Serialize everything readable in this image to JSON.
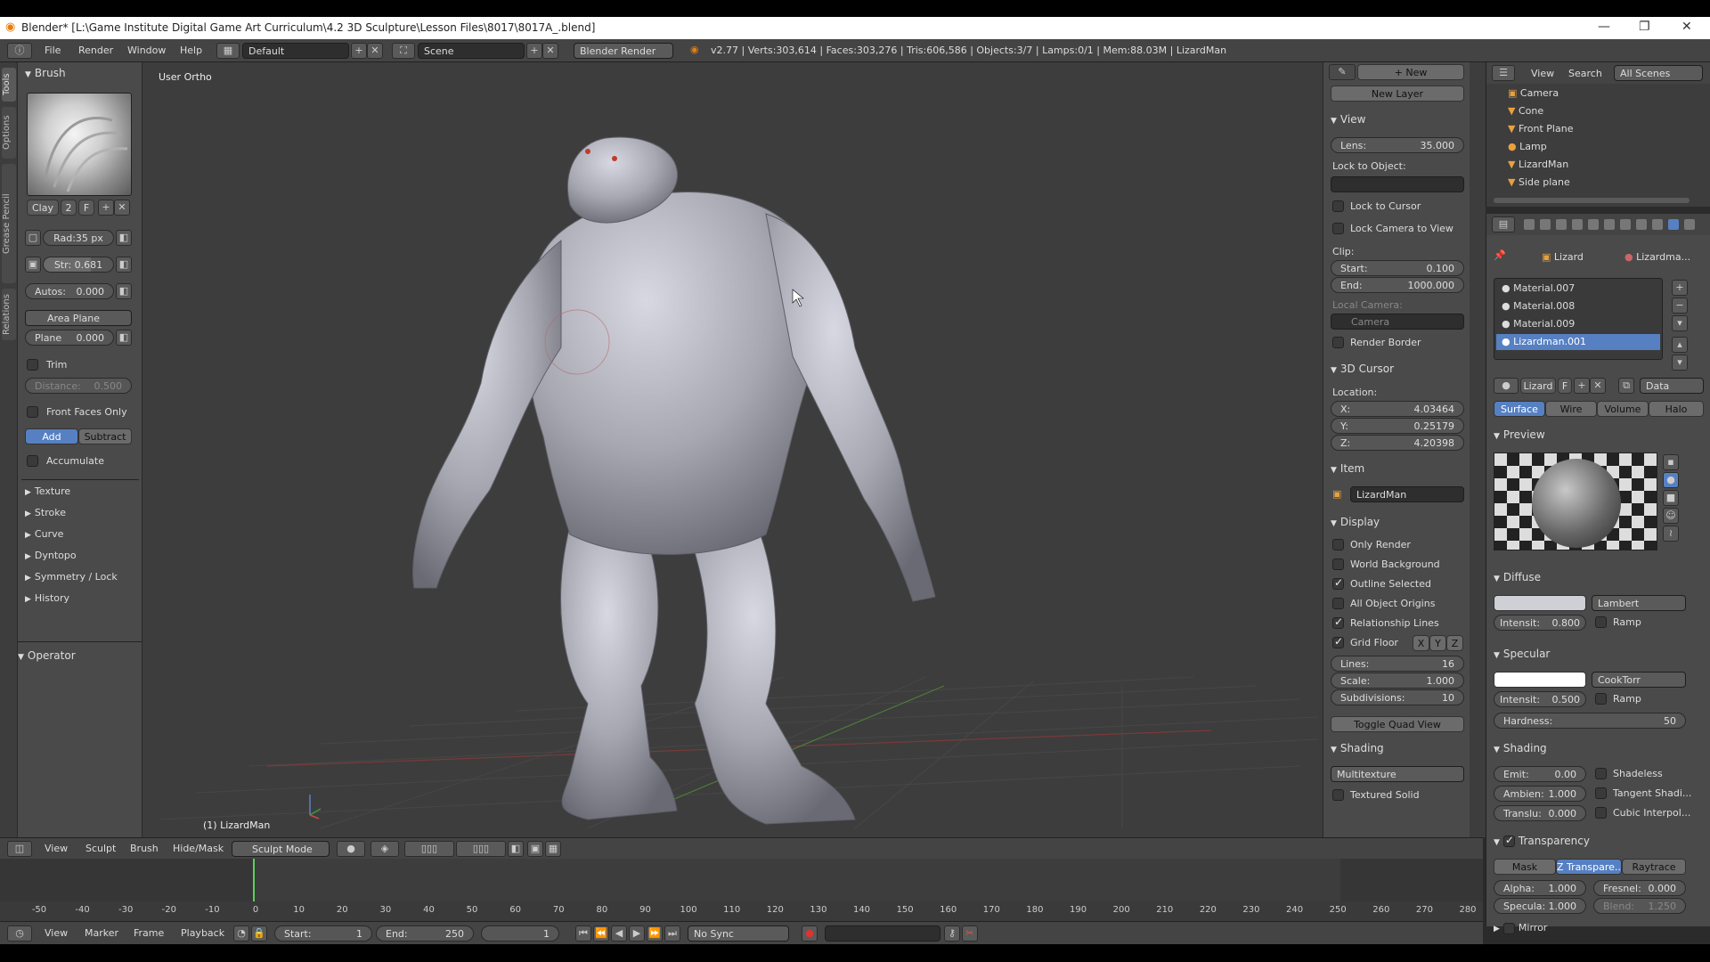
{
  "window": {
    "title": "Blender* [L:\\Game Institute Digital Game Art  Curriculum\\4.2 3D Sculpture\\Lesson Files\\8017\\8017A_.blend]",
    "minimize": "—",
    "maximize": "❐",
    "close": "✕"
  },
  "header": {
    "menu": [
      "File",
      "Render",
      "Window",
      "Help"
    ],
    "layout": "Default",
    "scene": "Scene",
    "engine": "Blender Render",
    "stats": "v2.77 | Verts:303,614 | Faces:303,276 | Tris:606,586 | Objects:3/7 | Lamps:0/1 | Mem:88.03M | LizardMan"
  },
  "left_tabs": [
    "Tools",
    "Options",
    "Grease Pencil",
    "Relations"
  ],
  "toolshelf": {
    "brush_header": "Brush",
    "brush_name": "Clay",
    "brush_users": "2",
    "brush_fake": "F",
    "radius": "Rad:35 px",
    "strength": "Str: 0.681",
    "autosmooth_label": "Autos:",
    "autosmooth_value": "0.000",
    "plane_mode": "Area Plane",
    "plane_label": "Plane",
    "plane_value": "0.000",
    "trim": "Trim",
    "distance_label": "Distance:",
    "distance_value": "0.500",
    "front_faces": "Front Faces Only",
    "add": "Add",
    "subtract": "Subtract",
    "accumulate": "Accumulate",
    "sections": [
      "Texture",
      "Stroke",
      "Curve",
      "Dyntopo",
      "Symmetry / Lock",
      "History"
    ],
    "operator": "Operator"
  },
  "viewport": {
    "view_name": "User Ortho",
    "object_label": "(1) LizardMan"
  },
  "npanel": {
    "new": "New",
    "new_layer": "New Layer",
    "view_header": "View",
    "lens_label": "Lens:",
    "lens_value": "35.000",
    "lock_to_object": "Lock to Object:",
    "lock_to_cursor": "Lock to Cursor",
    "lock_camera": "Lock Camera to View",
    "clip": "Clip:",
    "clip_start_label": "Start:",
    "clip_start": "0.100",
    "clip_end_label": "End:",
    "clip_end": "1000.000",
    "local_camera": "Local Camera:",
    "camera": "Camera",
    "render_border": "Render Border",
    "cursor_header": "3D Cursor",
    "location": "Location:",
    "x_label": "X:",
    "x": "4.03464",
    "y_label": "Y:",
    "y": "0.25179",
    "z_label": "Z:",
    "z": "4.20398",
    "item_header": "Item",
    "item_name": "LizardMan",
    "display_header": "Display",
    "only_render": "Only Render",
    "world_background": "World Background",
    "outline_selected": "Outline Selected",
    "all_origins": "All Object Origins",
    "relationship_lines": "Relationship Lines",
    "grid_floor": "Grid Floor",
    "axis_x": "X",
    "axis_y": "Y",
    "axis_z": "Z",
    "lines_label": "Lines:",
    "lines": "16",
    "scale_label": "Scale:",
    "scale": "1.000",
    "subdiv_label": "Subdivisions:",
    "subdiv": "10",
    "toggle_quad": "Toggle Quad View",
    "shading_header": "Shading",
    "shading_mode": "Multitexture",
    "textured_solid": "Textured Solid"
  },
  "outliner": {
    "view": "View",
    "search": "Search",
    "scope": "All Scenes",
    "items": [
      "Camera",
      "Cone",
      "Front Plane",
      "Lamp",
      "LizardMan",
      "Side plane"
    ]
  },
  "properties": {
    "crumb_object": "Lizard",
    "crumb_material": "Lizardma...",
    "materials": [
      "Material.007",
      "Material.008",
      "Material.009",
      "Lizardman.001"
    ],
    "mat_name": "Lizard",
    "mat_fake": "F",
    "data": "Data",
    "tabs": [
      "Surface",
      "Wire",
      "Volume",
      "Halo"
    ],
    "preview": "Preview",
    "diffuse": "Diffuse",
    "diffuse_shader": "Lambert",
    "diffuse_intensity_label": "Intensit:",
    "diffuse_intensity": "0.800",
    "ramp": "Ramp",
    "specular": "Specular",
    "specular_shader": "CookTorr",
    "specular_intensity_label": "Intensit:",
    "specular_intensity": "0.500",
    "hardness_label": "Hardness:",
    "hardness": "50",
    "shading": "Shading",
    "emit_label": "Emit:",
    "emit": "0.00",
    "ambient_label": "Ambien:",
    "ambient": "1.000",
    "translucency_label": "Translu:",
    "translucency": "0.000",
    "shadeless": "Shadeless",
    "tangent": "Tangent Shadi...",
    "cubic": "Cubic Interpol...",
    "transparency": "Transparency",
    "mask": "Mask",
    "ztransp": "Z Transpare...",
    "raytrace": "Raytrace",
    "alpha_label": "Alpha:",
    "alpha": "1.000",
    "fresnel_label": "Fresnel:",
    "fresnel": "0.000",
    "specular_alpha_label": "Specula:",
    "specular_alpha": "1.000",
    "blend_label": "Blend:",
    "blend": "1.250",
    "mirror": "Mirror"
  },
  "viewport_header": {
    "menu": [
      "View",
      "Sculpt",
      "Brush",
      "Hide/Mask"
    ],
    "mode": "Sculpt Mode"
  },
  "timeline": {
    "ticks": [
      "-50",
      "-40",
      "-30",
      "-20",
      "-10",
      "0",
      "10",
      "20",
      "30",
      "40",
      "50",
      "60",
      "70",
      "80",
      "90",
      "100",
      "110",
      "120",
      "130",
      "140",
      "150",
      "160",
      "170",
      "180",
      "190",
      "200",
      "210",
      "220",
      "230",
      "240",
      "250",
      "260",
      "270",
      "280"
    ],
    "current_frame_progress": 0.0
  },
  "timeline_header": {
    "menu": [
      "View",
      "Marker",
      "Frame",
      "Playback"
    ],
    "start_label": "Start:",
    "start": "1",
    "end_label": "End:",
    "end": "250",
    "current": "1",
    "sync": "No Sync"
  }
}
